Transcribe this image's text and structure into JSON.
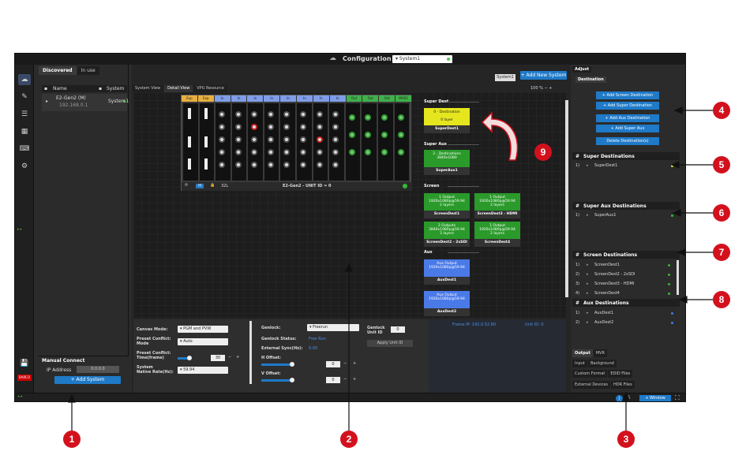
{
  "window": {
    "title": "Configuration",
    "system_select": "System1"
  },
  "left_panel": {
    "tabs": [
      "Discovered",
      "In use"
    ],
    "header": {
      "name": "Name",
      "system": "System"
    },
    "row": {
      "name": "E2-Gen2 (M)",
      "ip": "192.168.0.1",
      "system": "System1"
    },
    "manual_connect": {
      "title": "Manual Connect",
      "ip_label": "IP Address",
      "ip_value": "0.0.0.0",
      "add_button": "+ Add System"
    }
  },
  "center": {
    "tabs": [
      "System View",
      "Detail View",
      "VPU Resource"
    ],
    "system_tab": "System1",
    "add_new_system": "+ Add New System",
    "zoom": "100 %",
    "device": {
      "slots": [
        "Exp",
        "Exp",
        "In",
        "In",
        "In",
        "In",
        "In",
        "In",
        "In",
        "In",
        "Out",
        "Out",
        "Out",
        "MVR2"
      ],
      "name": "E2-Gen2 - UNIT ID = 0",
      "size": "32L",
      "badge": "M"
    },
    "sections": {
      "super_dest": "Super Dest",
      "super_aux": "Super Aux",
      "screen": "Screen",
      "aux": "Aux"
    },
    "super_dest": {
      "line1": "0 - Destination",
      "line2": "0 layer",
      "label": "SuperDest1"
    },
    "super_aux": {
      "line1": "2 - Destinations",
      "line2": "3840x1080",
      "label": "SuperAux1"
    },
    "screens": [
      {
        "l1": "1 Output",
        "l2": "1920x1080p@59.94",
        "l3": "2 layers",
        "label": "ScreenDest1"
      },
      {
        "l1": "1 Output",
        "l2": "1920x1080p@59.94",
        "l3": "2 layers",
        "label": "ScreenDest3 - HDMI"
      },
      {
        "l1": "2 Outputs",
        "l2": "3840x1080p@59.94",
        "l3": "3 layers",
        "label": "ScreenDest2 - 2xSDI"
      },
      {
        "l1": "1 Output",
        "l2": "1920x1080p@59.94",
        "l3": "2 layers",
        "label": "ScreenDest4"
      }
    ],
    "aux": [
      {
        "l1": "Aux Output",
        "l2": "1920x1080p@59.94",
        "label": "AuxDest1"
      },
      {
        "l1": "Aux Output",
        "l2": "1920x1080p@59.94",
        "label": "AuxDest2"
      }
    ],
    "bottom": {
      "canvas_mode_label": "Canvas Mode:",
      "canvas_mode_value": "PGM and PVW",
      "preset_conflict_label": "Preset Conflict:",
      "preset_conflict_label2": "Mode",
      "preset_conflict_value": "Auto",
      "preset_time_label": "Preset Conflict:",
      "preset_time_label2": "Time(frame)",
      "preset_time_value": "30",
      "native_rate_label": "System",
      "native_rate_label2": "Native Rate(Hz):",
      "native_rate_value": "59.94",
      "genlock_label": "Genlock:",
      "genlock_value": "Freerun",
      "genlock_status_label": "Genlock Status:",
      "genlock_status_value": "Free Run",
      "ext_sync_label": "External Sync(Hz):",
      "ext_sync_value": "0.00",
      "h_offset_label": "H Offset:",
      "h_offset_value": "0",
      "v_offset_label": "V Offset:",
      "v_offset_value": "0",
      "genlock_unit_label": "Genlock",
      "genlock_unit_label2": "Unit ID",
      "genlock_unit_value": "0",
      "apply_unit_id": "Apply Unit ID",
      "frame_ip": "Frame IP:  192.0.52.80",
      "unit_id": "Unit ID:  0"
    }
  },
  "adjust": {
    "tab": "Adjust",
    "dest_tab": "Destination",
    "buttons": [
      "+ Add Screen Destination",
      "+ Add Super Destination",
      "+ Add Aux Destination",
      "+ Add Super Aux",
      "Delete Destination(s)"
    ],
    "super_destinations": {
      "title": "Super Destinations",
      "rows": [
        {
          "n": "1)",
          "name": "SuperDest1"
        }
      ]
    },
    "super_aux_destinations": {
      "title": "Super Aux Destinations",
      "rows": [
        {
          "n": "1)",
          "name": "SuperAux1"
        }
      ]
    },
    "screen_destinations": {
      "title": "Screen Destinations",
      "rows": [
        {
          "n": "1)",
          "name": "ScreenDest1"
        },
        {
          "n": "2)",
          "name": "ScreenDest2 - 2xSDI"
        },
        {
          "n": "3)",
          "name": "ScreenDest3 - HDMI"
        },
        {
          "n": "4)",
          "name": "ScreenDest4"
        }
      ]
    },
    "aux_destinations": {
      "title": "Aux Destinations",
      "rows": [
        {
          "n": "1)",
          "name": "AuxDest1"
        },
        {
          "n": "2)",
          "name": "AuxDest2"
        }
      ]
    },
    "bottom_tabs1": [
      "Output",
      "MVR"
    ],
    "bottom_tabs2": [
      "Input",
      "Background"
    ],
    "bottom_tabs3": [
      "Custom Format",
      "EDID Files"
    ],
    "bottom_tabs4": [
      "External Devices",
      "HDR Files"
    ]
  },
  "statusbar": {
    "window_button": "+ Window",
    "page": "1",
    "info": "i"
  },
  "callouts": [
    "1",
    "2",
    "3",
    "4",
    "5",
    "6",
    "7",
    "8",
    "9"
  ],
  "colors": {
    "accent_blue": "#1f7ac8",
    "callout_red": "#d3111d",
    "green": "#2a9a2a",
    "yellow": "#e6e61e"
  }
}
